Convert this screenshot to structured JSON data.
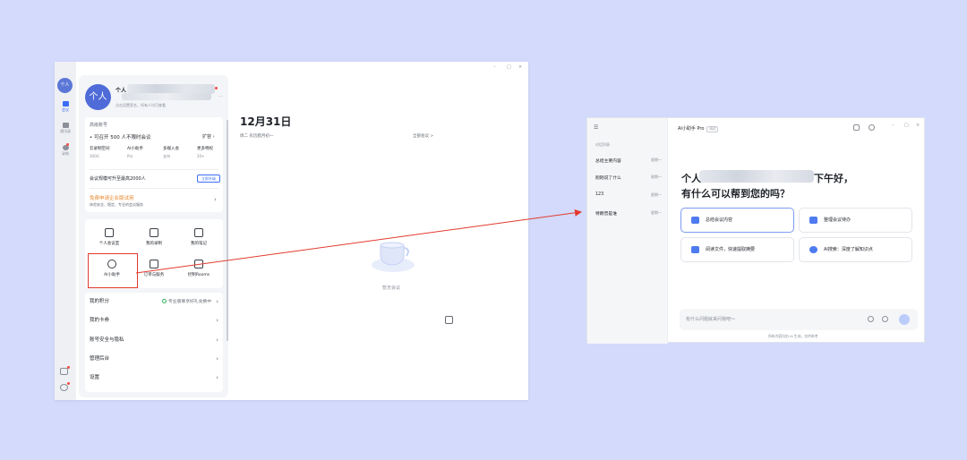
{
  "left_window": {
    "rail": {
      "avatar_text": "个人",
      "items": [
        {
          "label": "会议"
        },
        {
          "label": "通讯录"
        },
        {
          "label": "录制"
        }
      ]
    },
    "profile": {
      "avatar_text": "个人",
      "name": "个人",
      "signature": "点击设置签名，所有人均可查看"
    },
    "plan_card": {
      "title": "高级账号",
      "headline": "• 可召开 500 人不限时会议",
      "expand_label": "扩容",
      "features": [
        {
          "name": "云录制空间",
          "value": "300G"
        },
        {
          "name": "AI小助手",
          "value": "Pro"
        },
        {
          "name": "多端入会",
          "value": "支持"
        },
        {
          "name": "更多特权",
          "value": "20+"
        }
      ],
      "capacity": "会议规模可升至最高2000人",
      "upgrade_label": "立即升级",
      "trial_title": "免费申请企业版试用",
      "trial_sub": "体验安全、稳定、专业的会议服务"
    },
    "tools": [
      {
        "label": "个人会议室"
      },
      {
        "label": "我的录制"
      },
      {
        "label": "我的笔记"
      },
      {
        "label": "AI小助手"
      },
      {
        "label": "订单与服务"
      },
      {
        "label": "控制Rooms"
      }
    ],
    "menu": [
      {
        "label": "我的积分",
        "value": "专业版尊享好礼兑换中"
      },
      {
        "label": "我的卡券",
        "value": ""
      },
      {
        "label": "账号安全与隐私",
        "value": ""
      },
      {
        "label": "管理后台",
        "value": ""
      },
      {
        "label": "设置",
        "value": ""
      }
    ],
    "main": {
      "date": "12月31日",
      "subtitle": "周二 农历腊月初一",
      "all_meetings": "全部会议 >",
      "empty_text": "暂无会议"
    },
    "window_controls": [
      "–",
      "□",
      "×"
    ]
  },
  "right_window": {
    "title": "AI小助手 Pro",
    "tag": "测试",
    "history_header": "对话列表",
    "history": [
      {
        "title": "总结主要内容",
        "time": "星期一"
      },
      {
        "title": "刚刚说了什么",
        "time": "星期一"
      },
      {
        "title": "123",
        "time": "星期一"
      },
      {
        "title": "特朗普是谁",
        "time": "星期一"
      }
    ],
    "greeting_line1_prefix": "个人",
    "greeting_line1_suffix": "下午好，",
    "greeting_line2": "有什么可以帮到您的吗？",
    "suggestions": [
      {
        "label": "总结会议内容"
      },
      {
        "label": "整理会议待办"
      },
      {
        "label": "阅读文件，快速提取摘要"
      },
      {
        "label": "AI搜索：深度了解知识点"
      }
    ],
    "input_placeholder": "有什么问题就来问我吧～",
    "footer": "所有内容均由 AI 生成，仅供参考",
    "window_controls": [
      "–",
      "□",
      "×"
    ]
  },
  "colors": {
    "background": "#d3dafb",
    "accent": "#3b6ef5",
    "highlight": "#e23a2e"
  }
}
